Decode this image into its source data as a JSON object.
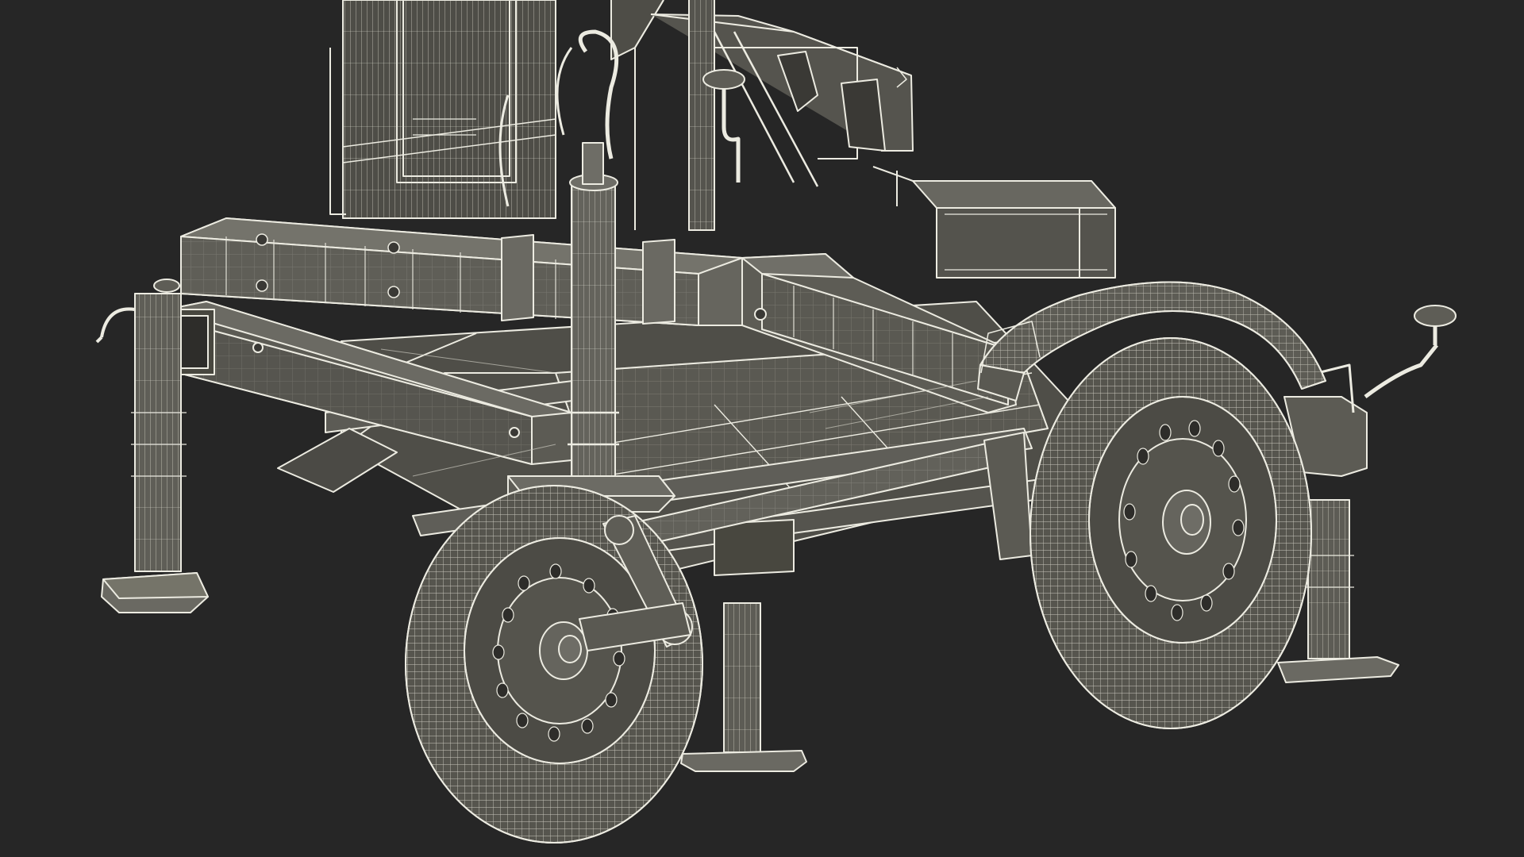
{
  "scene": {
    "subject": "trailer-wireframe-render",
    "colors": {
      "background": "#262626",
      "surface": "#5b5a53",
      "surface_dark": "#4a4944",
      "surface_light": "#6a6962",
      "wire": "#ecebe1",
      "wire_dim": "#c9c8bd"
    }
  }
}
